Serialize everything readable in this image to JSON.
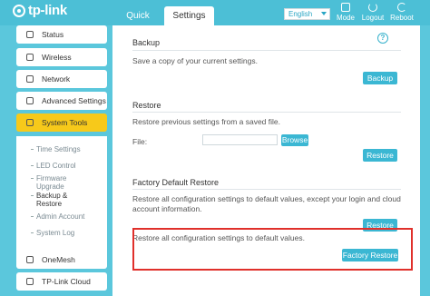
{
  "header": {
    "logo_text": "tp-link",
    "tabs": [
      "Quick Setup",
      "Settings"
    ],
    "language": "English",
    "buttons": {
      "mode": "Mode",
      "logout": "Logout",
      "reboot": "Reboot"
    }
  },
  "sidebar": {
    "items": [
      "Status",
      "Wireless",
      "Network",
      "Advanced Settings",
      "System Tools",
      "OneMesh",
      "TP-Link Cloud"
    ],
    "sub_items": [
      "Time Settings",
      "LED Control",
      "Firmware Upgrade",
      "Backup & Restore",
      "Admin Account",
      "System Log"
    ]
  },
  "main": {
    "help_icon": "?",
    "backup": {
      "title": "Backup",
      "desc": "Save a copy of your current settings.",
      "button": "Backup"
    },
    "restore": {
      "title": "Restore",
      "desc": "Restore previous settings from a saved file.",
      "file_label": "File:",
      "browse": "Browse",
      "button": "Restore"
    },
    "factory": {
      "title": "Factory Default Restore",
      "desc": "Restore all configuration settings to default values, except your login and cloud account information.",
      "button": "Restore",
      "desc2": "Restore all configuration settings to default values.",
      "button2": "Factory Restore"
    }
  },
  "colors": {
    "accent": "#3bb7d3",
    "active_menu": "#f7c91a",
    "highlight": "#e0302b"
  }
}
